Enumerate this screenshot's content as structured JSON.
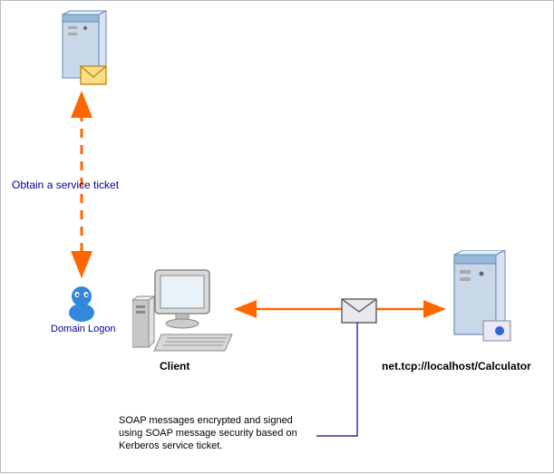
{
  "diagram": {
    "notes": {
      "service_ticket": "Obtain a service ticket",
      "domain_logon": "Domain Logon",
      "soap_line1": "SOAP messages encrypted and signed",
      "soap_line2": "using SOAP message security based on",
      "soap_line3": "Kerberos service ticket."
    },
    "labels": {
      "client": "Client",
      "server_url": "net.tcp://localhost/Calculator"
    },
    "icons": {
      "top_server": "server-with-envelope-icon",
      "user": "user-icon",
      "client_pc": "desktop-pc-icon",
      "envelope": "envelope-icon",
      "right_server": "server-with-folder-icon"
    }
  }
}
